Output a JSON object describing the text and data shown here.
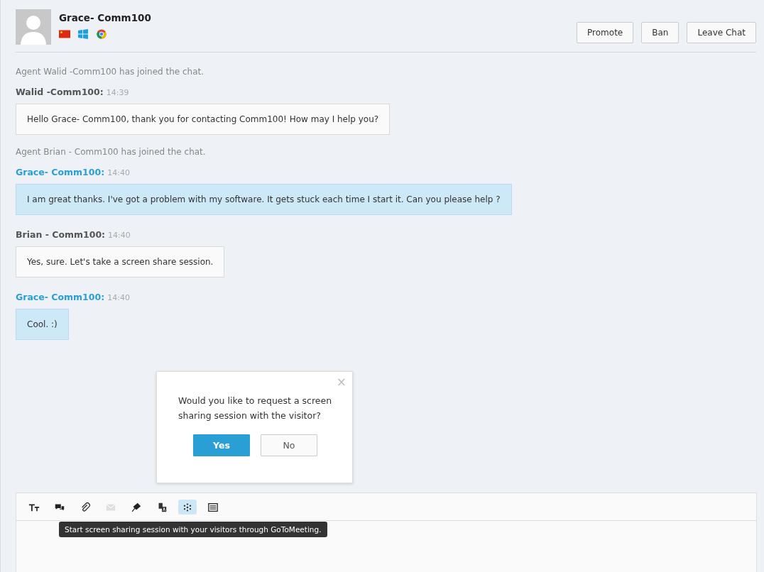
{
  "visitor": {
    "name": "Grace- Comm100"
  },
  "header_buttons": [
    "Promote",
    "Ban",
    "Leave Chat"
  ],
  "messages": [
    {
      "kind": "system",
      "text": "Agent Walid -Comm100 has joined the chat."
    },
    {
      "kind": "agent",
      "sender": "Walid -Comm100:",
      "time": "14:39",
      "text": "Hello Grace- Comm100, thank you for contacting Comm100! How may I help you?"
    },
    {
      "kind": "system",
      "text": "Agent Brian - Comm100 has joined the chat."
    },
    {
      "kind": "visitor",
      "sender": "Grace- Comm100:",
      "time": "14:40",
      "text": "I am great thanks. I've got a problem with my software. It gets stuck each time I start it. Can you please help ?"
    },
    {
      "kind": "agent",
      "sender": "Brian - Comm100:",
      "time": "14:40",
      "text": "Yes, sure. Let's take a screen share session."
    },
    {
      "kind": "visitor",
      "sender": "Grace- Comm100:",
      "time": "14:40",
      "text": "Cool. :)"
    }
  ],
  "popup": {
    "close": "×",
    "text": "Would you like to request a screen sharing session with the visitor?",
    "yes": "Yes",
    "no": "No"
  },
  "toolbar": [
    {
      "kind": "font",
      "disabled": false,
      "selected": false
    },
    {
      "kind": "canned",
      "disabled": false,
      "selected": false
    },
    {
      "kind": "attach",
      "disabled": false,
      "selected": false
    },
    {
      "kind": "mail",
      "disabled": true,
      "selected": false
    },
    {
      "kind": "pin",
      "disabled": false,
      "selected": false
    },
    {
      "kind": "translate",
      "disabled": false,
      "selected": false
    },
    {
      "kind": "screenshare",
      "disabled": false,
      "selected": true
    },
    {
      "kind": "list",
      "disabled": false,
      "selected": false
    }
  ],
  "tooltip": "Start screen sharing session with your visitors through GoToMeeting."
}
